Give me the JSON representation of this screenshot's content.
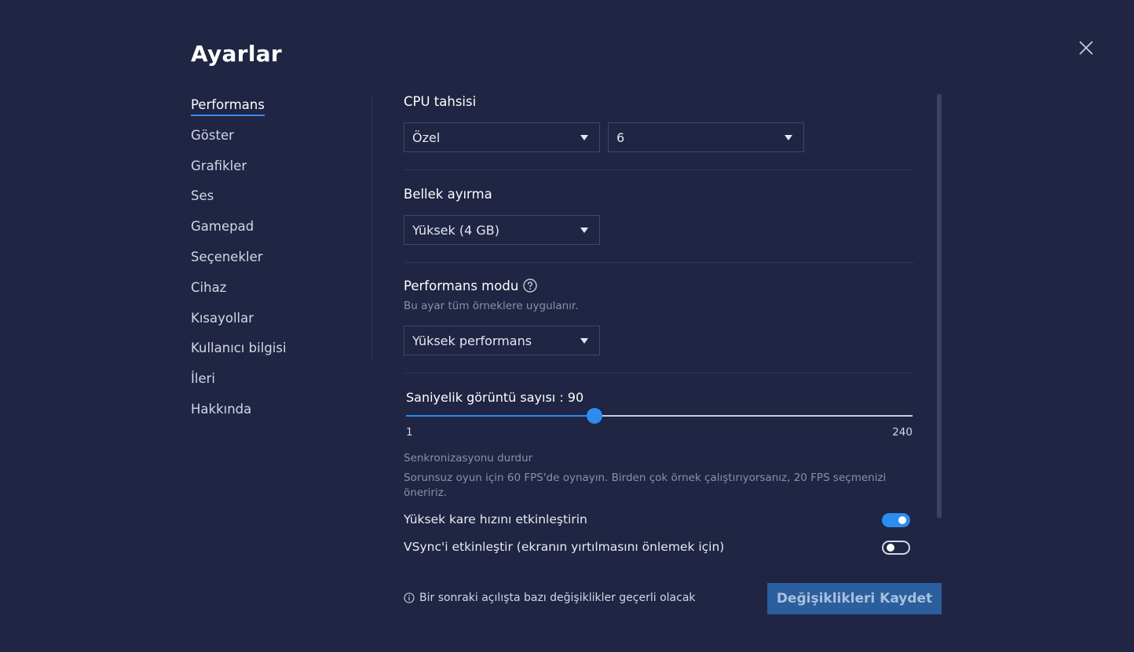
{
  "dialog": {
    "title": "Ayarlar"
  },
  "sidebar": {
    "items": [
      {
        "label": "Performans",
        "active": true
      },
      {
        "label": "Göster"
      },
      {
        "label": "Grafikler"
      },
      {
        "label": "Ses"
      },
      {
        "label": "Gamepad"
      },
      {
        "label": "Seçenekler"
      },
      {
        "label": "Cihaz"
      },
      {
        "label": "Kısayollar"
      },
      {
        "label": "Kullanıcı bilgisi"
      },
      {
        "label": "İleri"
      },
      {
        "label": "Hakkında"
      }
    ]
  },
  "cpu": {
    "title": "CPU tahsisi",
    "mode_value": "Özel",
    "cores_value": "6"
  },
  "memory": {
    "title": "Bellek ayırma",
    "value": "Yüksek (4 GB)"
  },
  "performance_mode": {
    "title": "Performans modu",
    "subtitle": "Bu ayar tüm örneklere uygulanır.",
    "value": "Yüksek performans"
  },
  "fps": {
    "label": "Saniyelik görüntü sayısı : 90",
    "min_label": "1",
    "max_label": "240",
    "value": 90,
    "min": 1,
    "max": 240,
    "sync_title": "Senkronizasyonu durdur",
    "sync_desc": "Sorunsuz oyun için 60 FPS'de oynayın. Birden çok örnek çalıştırıyorsanız, 20 FPS seçmenizi öneririz."
  },
  "toggles": {
    "high_frame_rate": {
      "label": "Yüksek kare hızını etkinleştirin",
      "on": true
    },
    "vsync": {
      "label": "VSync'i etkinleştir (ekranın yırtılmasını önlemek için)",
      "on": false
    }
  },
  "footer": {
    "note": "Bir sonraki açılışta bazı değişiklikler geçerli olacak",
    "save_label": "Değişiklikleri Kaydet"
  },
  "colors": {
    "background": "#1f2542",
    "accent": "#2d8cf0",
    "save_button": "#2b5e9c"
  },
  "icons": {
    "close": "close-icon",
    "help": "help-circle-icon",
    "info": "info-icon",
    "dropdown": "caret-down-icon"
  }
}
